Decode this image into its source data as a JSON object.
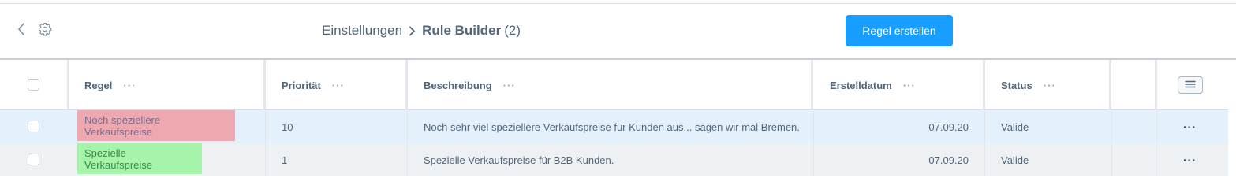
{
  "header": {
    "breadcrumb_root": "Einstellungen",
    "breadcrumb_current": "Rule Builder",
    "breadcrumb_count": "(2)",
    "create_button": "Regel erstellen"
  },
  "icons": {
    "back": "chevron-left-icon",
    "settings": "gear-icon",
    "breadcrumb_separator": "chevron-right-icon",
    "column_menu": "hamburger-menu-icon",
    "column_options": "more-horizontal-icon"
  },
  "table": {
    "columns": [
      {
        "label": "Regel",
        "options": "···"
      },
      {
        "label": "Priorität",
        "options": "···"
      },
      {
        "label": "Beschreibung",
        "options": "···"
      },
      {
        "label": "Erstelldatum",
        "options": "···"
      },
      {
        "label": "Status",
        "options": "···"
      }
    ],
    "rows": [
      {
        "name": "Noch speziellere Verkaufspreise",
        "priority": "10",
        "description": "Noch sehr viel speziellere Verkaufspreise für Kunden aus... sagen wir mal Bremen.",
        "created": "07.09.20",
        "status": "Valide",
        "actions": "···",
        "tag_bg": "#eea8b0",
        "tag_fg": "#7a6b8e",
        "row_bg": "#e4f1fd"
      },
      {
        "name": "Spezielle Verkaufspreise",
        "priority": "1",
        "description": "Spezielle Verkaufspreise für B2B Kunden.",
        "created": "07.09.20",
        "status": "Valide",
        "actions": "···",
        "tag_bg": "#a6f4a9",
        "tag_fg": "#3b8a4a",
        "row_bg": "#eef1f4"
      }
    ]
  },
  "colors": {
    "primary": "#189eff",
    "text": "#52667a",
    "border": "#d9dde3"
  }
}
